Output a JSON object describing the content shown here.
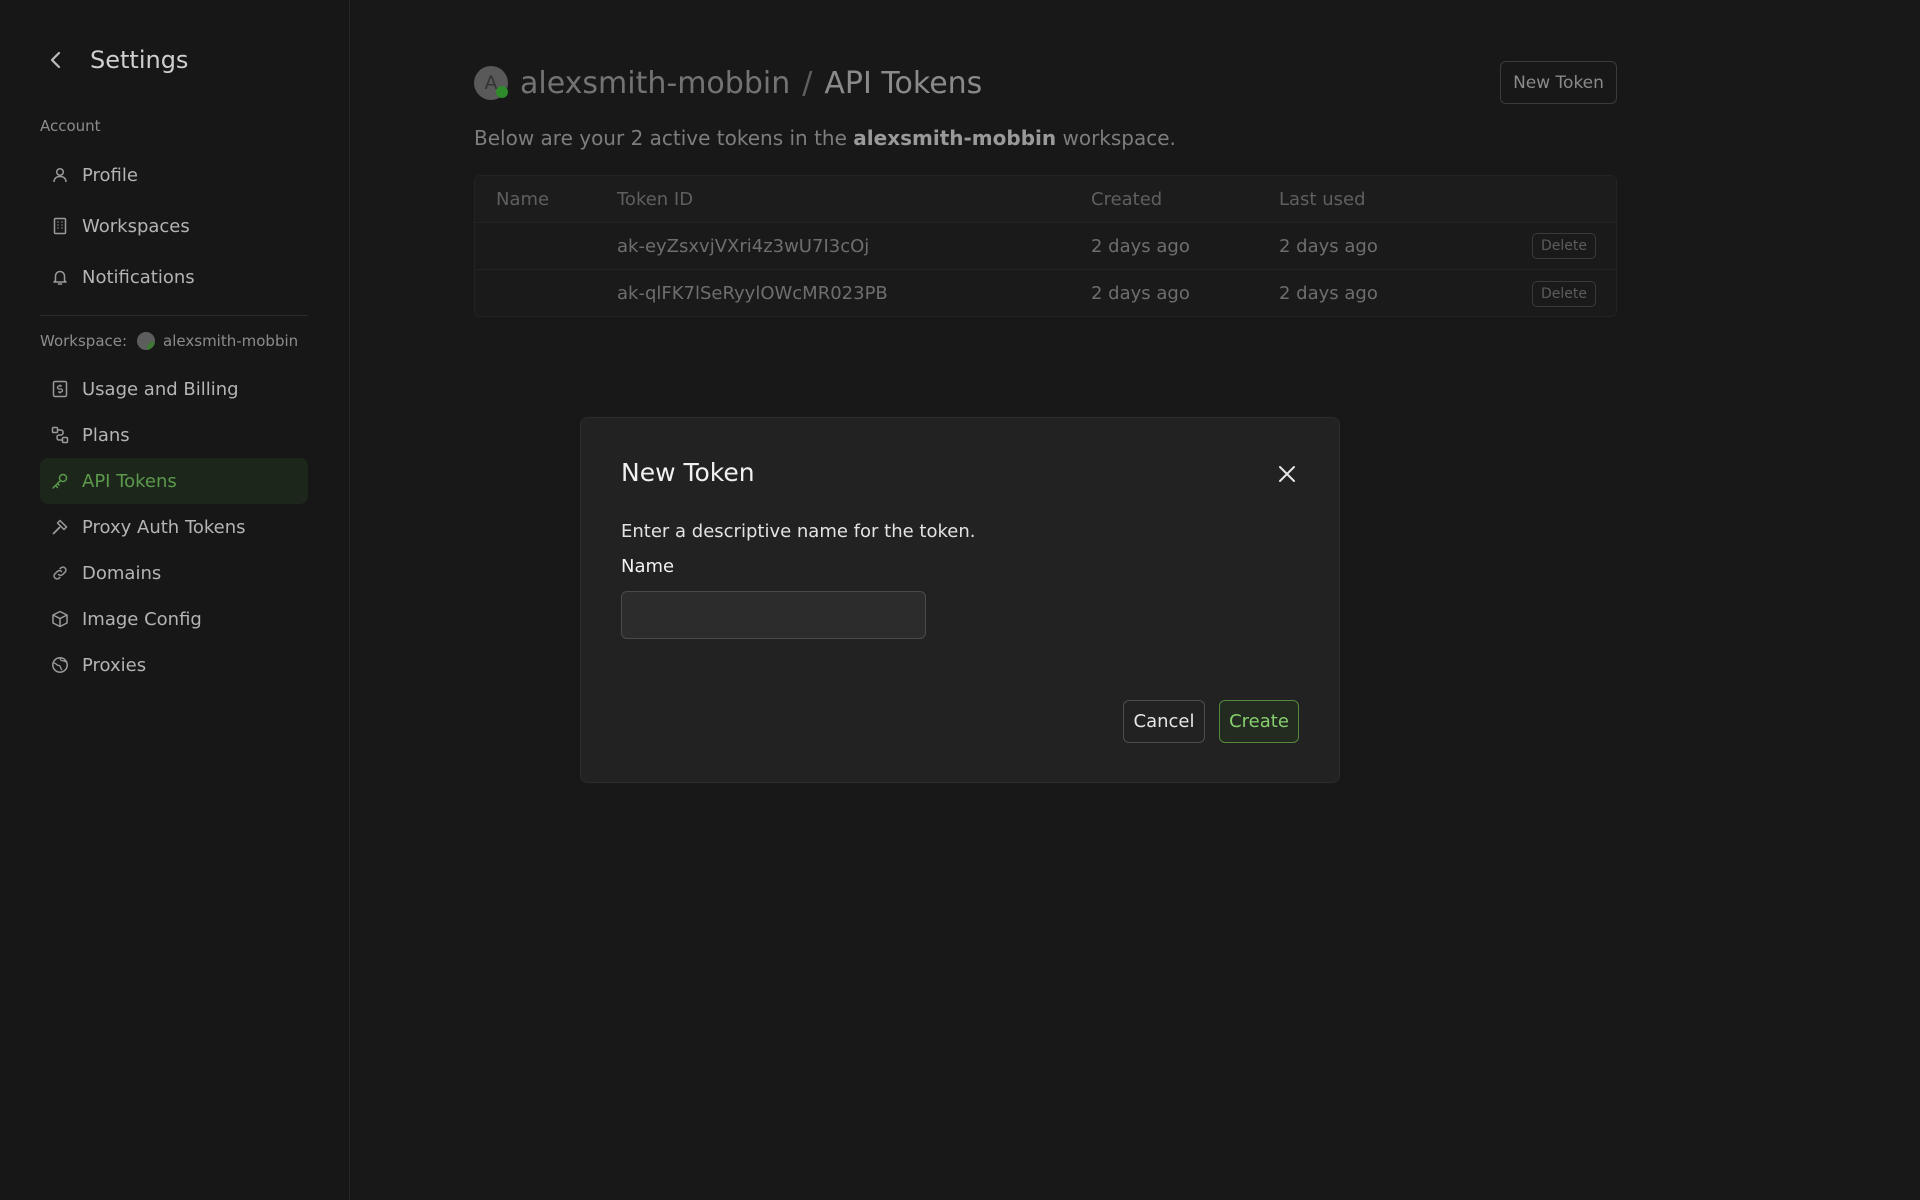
{
  "sidebar": {
    "title": "Settings",
    "account_label": "Account",
    "account_items": [
      {
        "label": "Profile",
        "icon": "user-icon"
      },
      {
        "label": "Workspaces",
        "icon": "building-icon"
      },
      {
        "label": "Notifications",
        "icon": "bell-icon"
      }
    ],
    "workspace_label": "Workspace:",
    "workspace_name": "alexsmith-mobbin",
    "workspace_items": [
      {
        "label": "Usage and Billing",
        "icon": "dollar-receipt-icon"
      },
      {
        "label": "Plans",
        "icon": "route-icon"
      },
      {
        "label": "API Tokens",
        "icon": "key-icon",
        "active": true
      },
      {
        "label": "Proxy Auth Tokens",
        "icon": "hammer-icon"
      },
      {
        "label": "Domains",
        "icon": "link-icon"
      },
      {
        "label": "Image Config",
        "icon": "package-icon"
      },
      {
        "label": "Proxies",
        "icon": "globe-icon"
      }
    ]
  },
  "header": {
    "avatar_letter": "A",
    "workspace": "alexsmith-mobbin",
    "separator": "/",
    "page_title": "API Tokens",
    "new_token_label": "New Token"
  },
  "subtitle": {
    "prefix": "Below are your 2 active tokens in the",
    "workspace": "alexsmith-mobbin",
    "suffix": "workspace."
  },
  "table": {
    "columns": [
      "Name",
      "Token ID",
      "Created",
      "Last used"
    ],
    "rows": [
      {
        "name": "",
        "token_id": "ak-eyZsxvjVXri4z3wU7I3cOj",
        "created": "2 days ago",
        "last_used": "2 days ago",
        "action": "Delete"
      },
      {
        "name": "",
        "token_id": "ak-qlFK7lSeRyylOWcMR023PB",
        "created": "2 days ago",
        "last_used": "2 days ago",
        "action": "Delete"
      }
    ]
  },
  "modal": {
    "title": "New Token",
    "description": "Enter a descriptive name for the token.",
    "name_label": "Name",
    "name_value": "",
    "cancel_label": "Cancel",
    "create_label": "Create"
  },
  "colors": {
    "background": "#181818",
    "accent_green": "#5b9a4c",
    "create_green": "#86cf6e"
  }
}
